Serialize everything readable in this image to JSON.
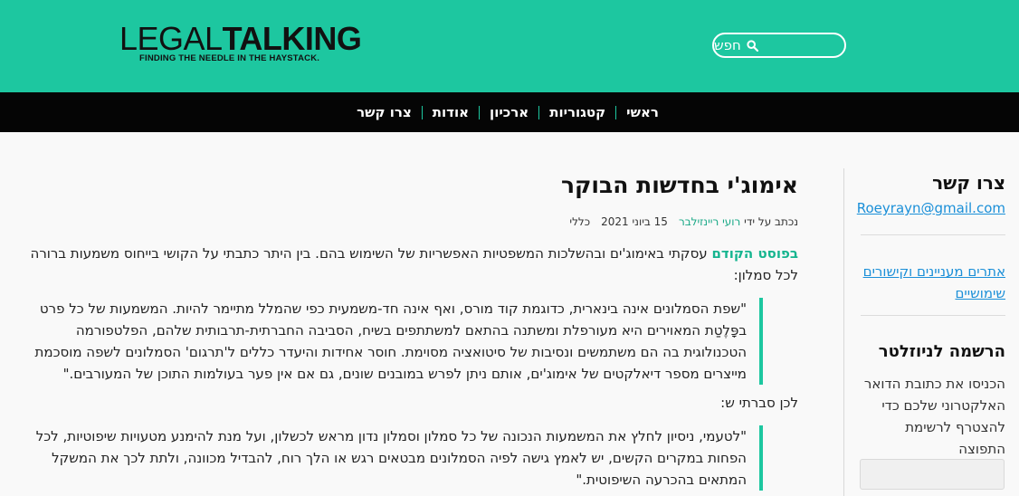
{
  "header": {
    "logo_part1": "LEGAL",
    "logo_part2": "TALKING",
    "tagline": "FINDING THE NEEDLE IN THE HAYSTACK.",
    "search_label": "חפש",
    "search_icon": "search-icon",
    "accent_color": "#1dc7a0"
  },
  "nav": {
    "items": [
      {
        "label": "ראשי"
      },
      {
        "label": "קטגוריות"
      },
      {
        "label": "ארכיון"
      },
      {
        "label": "אודות"
      },
      {
        "label": "צרו קשר"
      }
    ]
  },
  "post": {
    "title": "אימוג'י בחדשות הבוקר",
    "meta": {
      "written_by_prefix": "נכתב על ידי",
      "author": "רועי ריינזילבר",
      "date": "15 ביוני 2021",
      "category": "כללי"
    },
    "intro_link": "בפוסט הקודם",
    "intro_text": " עסקתי באימוג'ים ובהשלכות המשפטיות האפשריות של השימוש בהם. בין היתר כתבתי על הקושי בייחוס משמעות ברורה לכל סמלון:",
    "quote1": "\"שפת הסמלונים אינה בינארית, כדוגמת קוד מורס, ואף אינה חד-משמעית כפי שהמלל מתיימר להיות. המשמעות של כל פרט בפָּלֶטַת המאוירים היא מעורפלת ומשתנה בהתאם למשתתפים בשיח, הסביבה החברתית-תרבותית שלהם, הפלטפורמה הטכנולוגית בה הם משתמשים ונסיבות של סיטואציה מסוימת. חוסר אחידות והיעדר כללים ל'תרגום' הסמלונים לשפה מוסכמת מייצרים מספר דיאלקטים של אימוג'ים, אותם ניתן לפרש במובנים שונים, גם אם אין פער בעולמות התוכן של המעורבים.\"",
    "para2": "לכן סברתי ש:",
    "quote2": "\"לטעמי, ניסיון לחלץ את המשמעות הנכונה של כל סמלון וסמלון נדון מראש לכשלון, ועל מנת להימנע מטעויות שיפוטיות, לכל הפחות במקרים הקשים, יש לאמץ גישה לפיה הסמלונים מבטאים רגש או הלך רוח, להבדיל מכוונה, ולתת לכך את המשקל המתאים בהכרעה השיפוטית.\""
  },
  "sidebar": {
    "contact_title": "צרו קשר",
    "email": "Roeyrayn@gmail.com",
    "links_text": "אתרים מעניינים וקישורים שימושיים",
    "newsletter_title": "הרשמה לניוזלטר",
    "newsletter_desc": "הכניסו את כתובת הדואר האלקטרוני שלכם כדי להצטרף לרשימת התפוצה"
  }
}
